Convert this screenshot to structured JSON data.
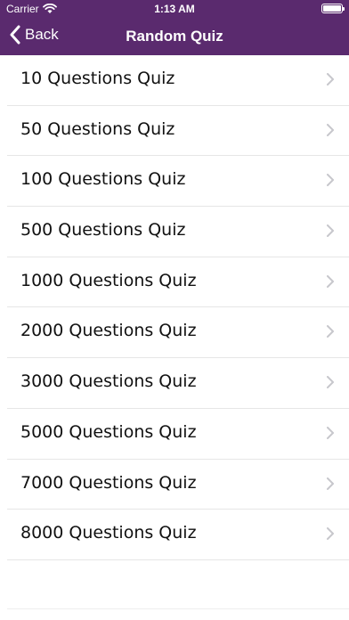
{
  "status_bar": {
    "carrier": "Carrier",
    "time": "1:13 AM",
    "battery_level": 1.0
  },
  "nav": {
    "back_label": "Back",
    "title": "Random Quiz"
  },
  "quiz_list": [
    {
      "label": "10 Questions Quiz"
    },
    {
      "label": "50 Questions Quiz"
    },
    {
      "label": "100 Questions Quiz"
    },
    {
      "label": "500 Questions Quiz"
    },
    {
      "label": "1000 Questions Quiz"
    },
    {
      "label": "2000 Questions Quiz"
    },
    {
      "label": "3000 Questions Quiz"
    },
    {
      "label": "5000 Questions Quiz"
    },
    {
      "label": "7000 Questions Quiz"
    },
    {
      "label": "8000 Questions Quiz"
    }
  ],
  "colors": {
    "header_bg": "#5a2a6e",
    "header_text": "#ffffff",
    "row_text": "#111111",
    "chevron": "#c7c7cc",
    "separator": "#e6e6e6"
  }
}
